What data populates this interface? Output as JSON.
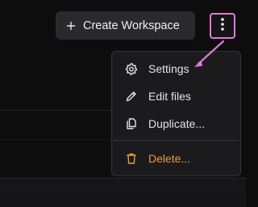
{
  "toolbar": {
    "create_label": "Create Workspace",
    "create_icon": "plus-icon",
    "more_icon": "kebab-icon"
  },
  "menu": {
    "items": [
      {
        "label": "Settings",
        "icon": "gear-icon"
      },
      {
        "label": "Edit files",
        "icon": "pencil-icon"
      },
      {
        "label": "Duplicate...",
        "icon": "copy-icon"
      },
      {
        "label": "Delete...",
        "icon": "trash-icon",
        "color": "#e99a3e"
      }
    ]
  },
  "colors": {
    "highlight": "#e27ad4",
    "danger": "#e99a3e"
  }
}
